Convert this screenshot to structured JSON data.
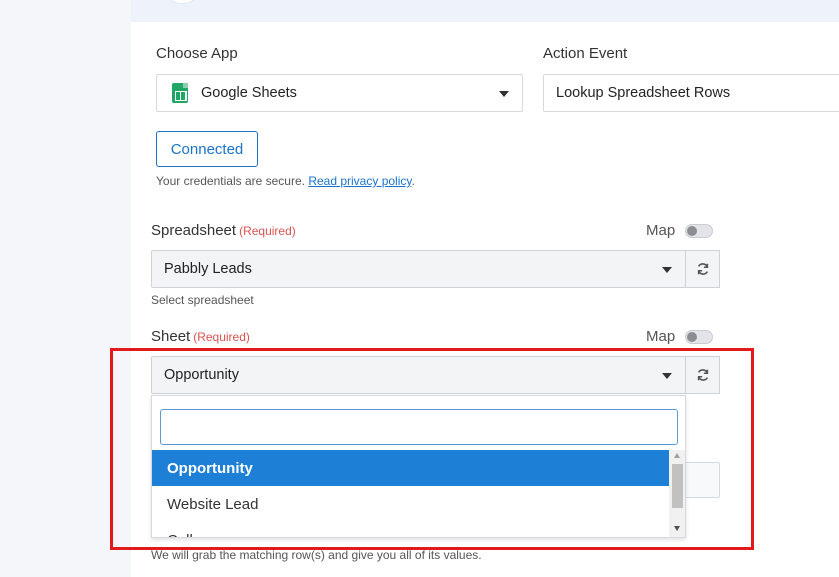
{
  "choose_app": {
    "label": "Choose App",
    "value": "Google Sheets",
    "icon": "google-sheets-icon"
  },
  "action_event": {
    "label": "Action Event",
    "value": "Lookup Spreadsheet Rows"
  },
  "connection": {
    "button_label": "Connected",
    "credentials_text": "Your credentials are secure.",
    "privacy_link": "Read privacy policy",
    "period": "."
  },
  "spreadsheet": {
    "label": "Spreadsheet",
    "required": "(Required)",
    "map_label": "Map",
    "value": "Pabbly Leads",
    "help": "Select spreadsheet"
  },
  "sheet": {
    "label": "Sheet",
    "required": "(Required)",
    "map_label": "Map",
    "value": "Opportunity",
    "dropdown": {
      "search_value": "",
      "options": [
        "Opportunity",
        "Website Lead",
        "Call"
      ],
      "selected_index": 0
    }
  },
  "bottom_help": "We will grab the matching row(s) and give you all of its values.",
  "colors": {
    "accent": "#1a73c9",
    "selected": "#1e7fd6",
    "required": "#d9534f",
    "highlight": "#e11b1b"
  }
}
